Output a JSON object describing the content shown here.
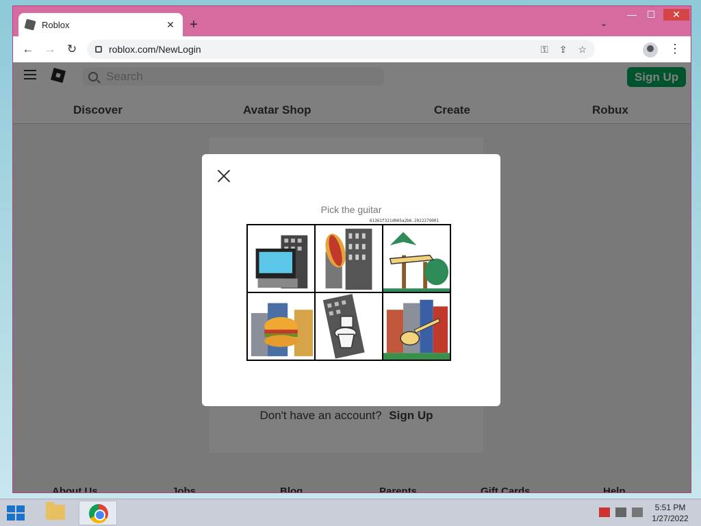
{
  "browser": {
    "tab_title": "Roblox",
    "tab_close": "✕",
    "new_tab": "+",
    "tab_dropdown": "⌄",
    "url": "roblox.com/NewLogin",
    "window_controls": {
      "minimize": "—",
      "maximize": "☐",
      "close": "✕"
    }
  },
  "header": {
    "search_placeholder": "Search",
    "signup_label": "Sign Up"
  },
  "nav": {
    "items": [
      "Discover",
      "Avatar Shop",
      "Create",
      "Robux"
    ]
  },
  "login": {
    "no_account": "Don't have an account?",
    "signup_link": "Sign Up"
  },
  "footer": {
    "items": [
      "About Us",
      "Jobs",
      "Blog",
      "Parents",
      "Gift Cards",
      "Help"
    ]
  },
  "captcha": {
    "prompt": "Pick the guitar",
    "challenge_id": "61361f321d065a2b6.2022279001",
    "tiles": [
      {
        "name": "captcha-tile-computer",
        "subject": "computer"
      },
      {
        "name": "captcha-tile-hotdog",
        "subject": "hotdog"
      },
      {
        "name": "captcha-tile-airplane",
        "subject": "airplane"
      },
      {
        "name": "captcha-tile-burger",
        "subject": "burger"
      },
      {
        "name": "captcha-tile-toilet",
        "subject": "toilet"
      },
      {
        "name": "captcha-tile-guitar",
        "subject": "guitar"
      }
    ]
  },
  "taskbar": {
    "time": "5:51 PM",
    "date": "1/27/2022"
  }
}
